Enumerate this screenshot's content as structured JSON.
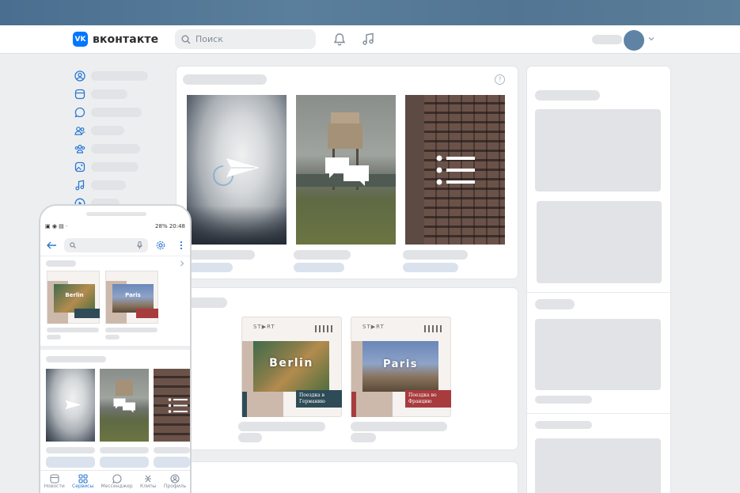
{
  "header": {
    "logo_mark": "VK",
    "logo_text": "вконтакте",
    "search_placeholder": "Поиск",
    "bell_icon": "bell-icon",
    "music_icon": "music-icon"
  },
  "colors": {
    "accent": "#0077ff",
    "mobile_accent": "#2a78d4",
    "berlin_panel": "#2e4b57",
    "paris_panel": "#a83b3e",
    "placeholder": "#e1e3e6",
    "placeholder_blue": "#dae2ed"
  },
  "sidebar": {
    "items": [
      {
        "icon": "profile-icon"
      },
      {
        "icon": "news-icon"
      },
      {
        "icon": "messenger-icon"
      },
      {
        "icon": "friends-icon"
      },
      {
        "icon": "communities-icon"
      },
      {
        "icon": "photos-icon"
      },
      {
        "icon": "music-icon"
      },
      {
        "icon": "video-icon"
      }
    ]
  },
  "cards": {
    "stories_help": "?",
    "berlin": {
      "brand": "ST▶RT",
      "city": "Berlin",
      "caption": "Поездка в Германию"
    },
    "paris": {
      "brand": "ST▶RT",
      "city": "Paris",
      "caption": "Поездка во Францию"
    }
  },
  "mobile": {
    "status_right": "28% 20:48",
    "tabs": [
      {
        "label": "Новости",
        "icon": "news-icon"
      },
      {
        "label": "Сервисы",
        "icon": "services-icon",
        "active": true
      },
      {
        "label": "Мессенджер",
        "icon": "messenger-icon"
      },
      {
        "label": "Клипы",
        "icon": "clips-icon"
      },
      {
        "label": "Профиль",
        "icon": "profile-icon"
      }
    ]
  }
}
